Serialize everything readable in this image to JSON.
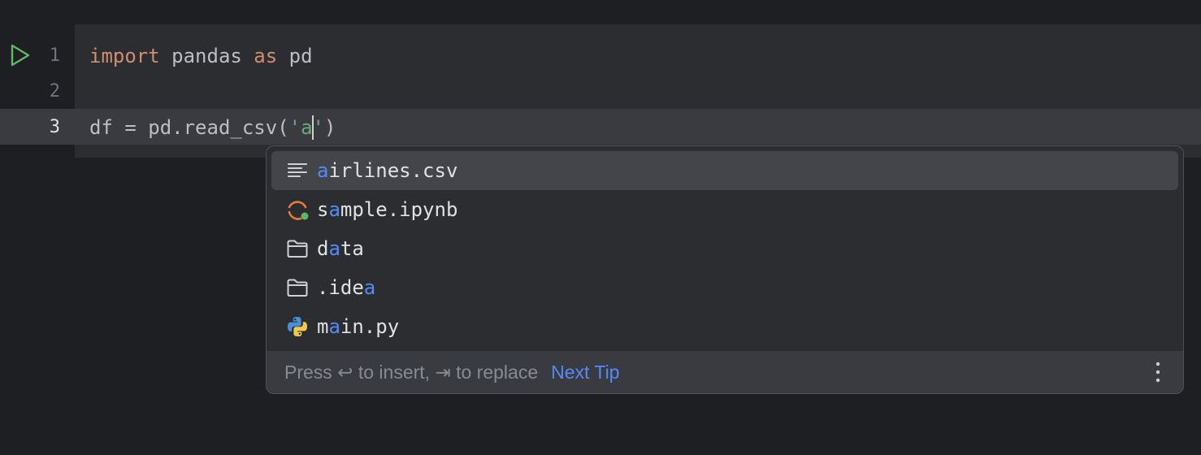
{
  "gutter": {
    "line_numbers": [
      "1",
      "2",
      "3"
    ],
    "run_icon": "run-cell-icon"
  },
  "code": {
    "line1": {
      "kw1": "import",
      "mid": " pandas ",
      "kw2": "as",
      "end": " pd"
    },
    "line3": {
      "prefix": "df = pd.read_csv(",
      "str_open": "'a",
      "str_close": "'",
      "suffix": ")"
    }
  },
  "completion": {
    "items": [
      {
        "icon": "text-file-icon",
        "pre": "",
        "match": "a",
        "post": "irlines.csv"
      },
      {
        "icon": "jupyter-notebook-icon",
        "pre": "s",
        "match": "a",
        "post": "mple.ipynb"
      },
      {
        "icon": "folder-icon",
        "pre": "d",
        "match": "a",
        "post": "ta"
      },
      {
        "icon": "folder-icon",
        "pre": ".ide",
        "match": "a",
        "post": ""
      },
      {
        "icon": "python-file-icon",
        "pre": "m",
        "match": "a",
        "post": "in.py"
      }
    ],
    "selected_index": 0,
    "footer": {
      "hint": "Press ↩ to insert, ⇥ to replace",
      "next_tip": "Next Tip",
      "more_icon": "more-vertical-icon"
    }
  },
  "colors": {
    "keyword": "#cf8e6d",
    "string": "#6aab73",
    "match_highlight": "#548af7",
    "background": "#1e1f22"
  }
}
